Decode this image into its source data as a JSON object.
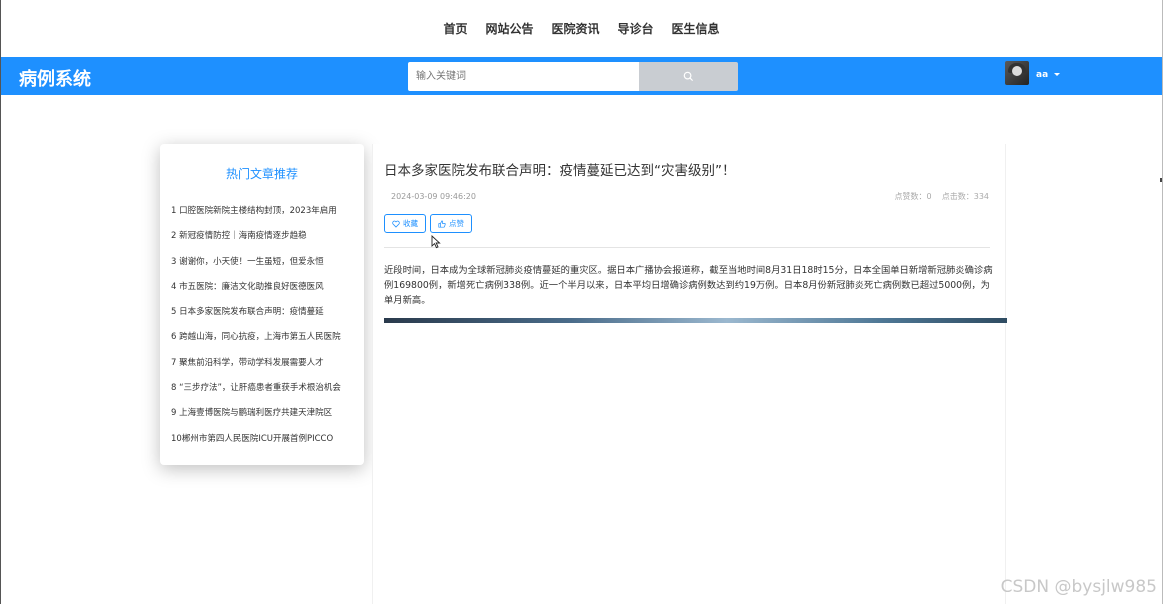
{
  "topnav": {
    "items": [
      "首页",
      "网站公告",
      "医院资讯",
      "导诊台",
      "医生信息"
    ]
  },
  "header": {
    "logo": "病例系统",
    "search_placeholder": "输入关键词",
    "username": "aa"
  },
  "hot_articles": {
    "title": "热门文章推荐",
    "items": [
      "1  口腔医院新院主楼结构封顶，2023年启用",
      "2  新冠疫情防控｜海南疫情逐步趋稳",
      "3  谢谢你，小天使！一生虽短，但爱永恒",
      "4  市五医院：廉洁文化助推良好医德医风",
      "5  日本多家医院发布联合声明：疫情蔓延",
      "6  跨越山海，同心抗疫，上海市第五人民医院",
      "7  聚焦前沿科学，带动学科发展需要人才",
      "8  “三步疗法”，让肝癌患者重获手术根治机会",
      "9  上海壹博医院与鹏瑞利医疗共建天津院区",
      "10郴州市第四人民医院ICU开展首例PICCO"
    ]
  },
  "article": {
    "title": "日本多家医院发布联合声明：疫情蔓延已达到“灾害级别”！",
    "date": "2024-03-09 09:46:20",
    "stats": "点赞数：0    点击数：334",
    "favorite_label": "收藏",
    "like_label": "点赞",
    "body": "近段时间，日本成为全球新冠肺炎疫情蔓延的重灾区。据日本广播协会报道称，截至当地时间8月31日18时15分，日本全国单日新增新冠肺炎确诊病例169800例，新增死亡病例338例。近一个半月以来，日本平均日增确诊病例数达到约19万例。日本8月份新冠肺炎死亡病例数已超过5000例，为单月新高。"
  },
  "watermark": "CSDN @bysjlw985",
  "colors": {
    "primary": "#1e90ff",
    "search_button": "#c9cdd2"
  }
}
